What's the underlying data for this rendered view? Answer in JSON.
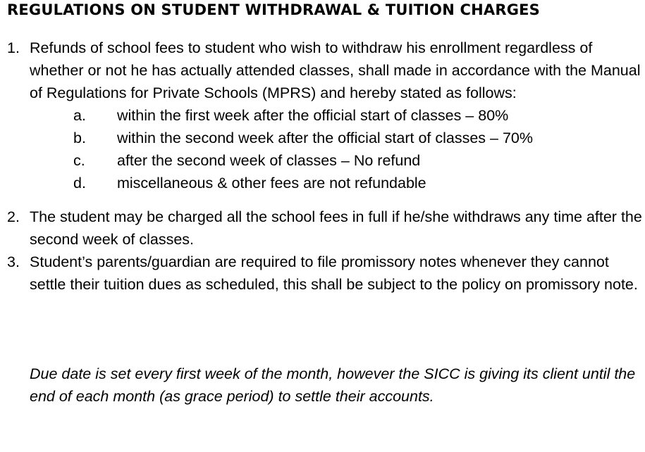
{
  "document": {
    "title": "REGULATIONS ON STUDENT WITHDRAWAL & TUITION CHARGES",
    "items": [
      {
        "number": "1.",
        "text": "Refunds of school fees to student who wish to withdraw his enrollment regardless of whether or not he has actually attended classes, shall made in accordance with the Manual of Regulations for Private Schools (MPRS) and hereby stated as follows:",
        "subitems": [
          {
            "letter": "a.",
            "text": "within the first week after the official start of classes – 80%"
          },
          {
            "letter": "b.",
            "text": "within the second week after the official start of classes – 70%"
          },
          {
            "letter": "c.",
            "text": "after the second week of classes – No refund"
          },
          {
            "letter": "d.",
            "text": "miscellaneous & other fees are not refundable"
          }
        ]
      },
      {
        "number": "2.",
        "text": "The student may be charged all the school fees in full if he/she withdraws any time after the second week of classes."
      },
      {
        "number": "3.",
        "text": "Student’s parents/guardian are required to file promissory notes whenever they cannot settle their tuition dues as scheduled, this shall be subject to the policy on promissory note."
      }
    ],
    "note": "Due date is set every first week of the month, however the SICC is giving its client until the end of each month (as grace period) to settle their accounts."
  }
}
